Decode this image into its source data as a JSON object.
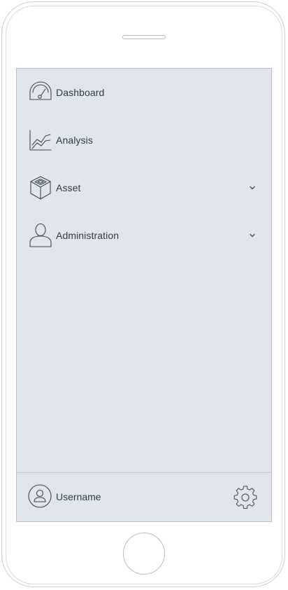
{
  "menu": {
    "items": [
      {
        "label": "Dashboard",
        "icon": "speedometer-icon",
        "expandable": false
      },
      {
        "label": "Analysis",
        "icon": "line-chart-icon",
        "expandable": false
      },
      {
        "label": "Asset",
        "icon": "box-icon",
        "expandable": true
      },
      {
        "label": "Administration",
        "icon": "user-icon",
        "expandable": true
      }
    ]
  },
  "footer": {
    "username": "Username",
    "avatar_icon": "user-avatar-icon",
    "settings_icon": "gear-icon"
  },
  "colors": {
    "screen_background": "#e1e6ec",
    "text": "#2f3a45",
    "icon_stroke": "#3d4752",
    "device_frame": "#c6ccd2"
  }
}
